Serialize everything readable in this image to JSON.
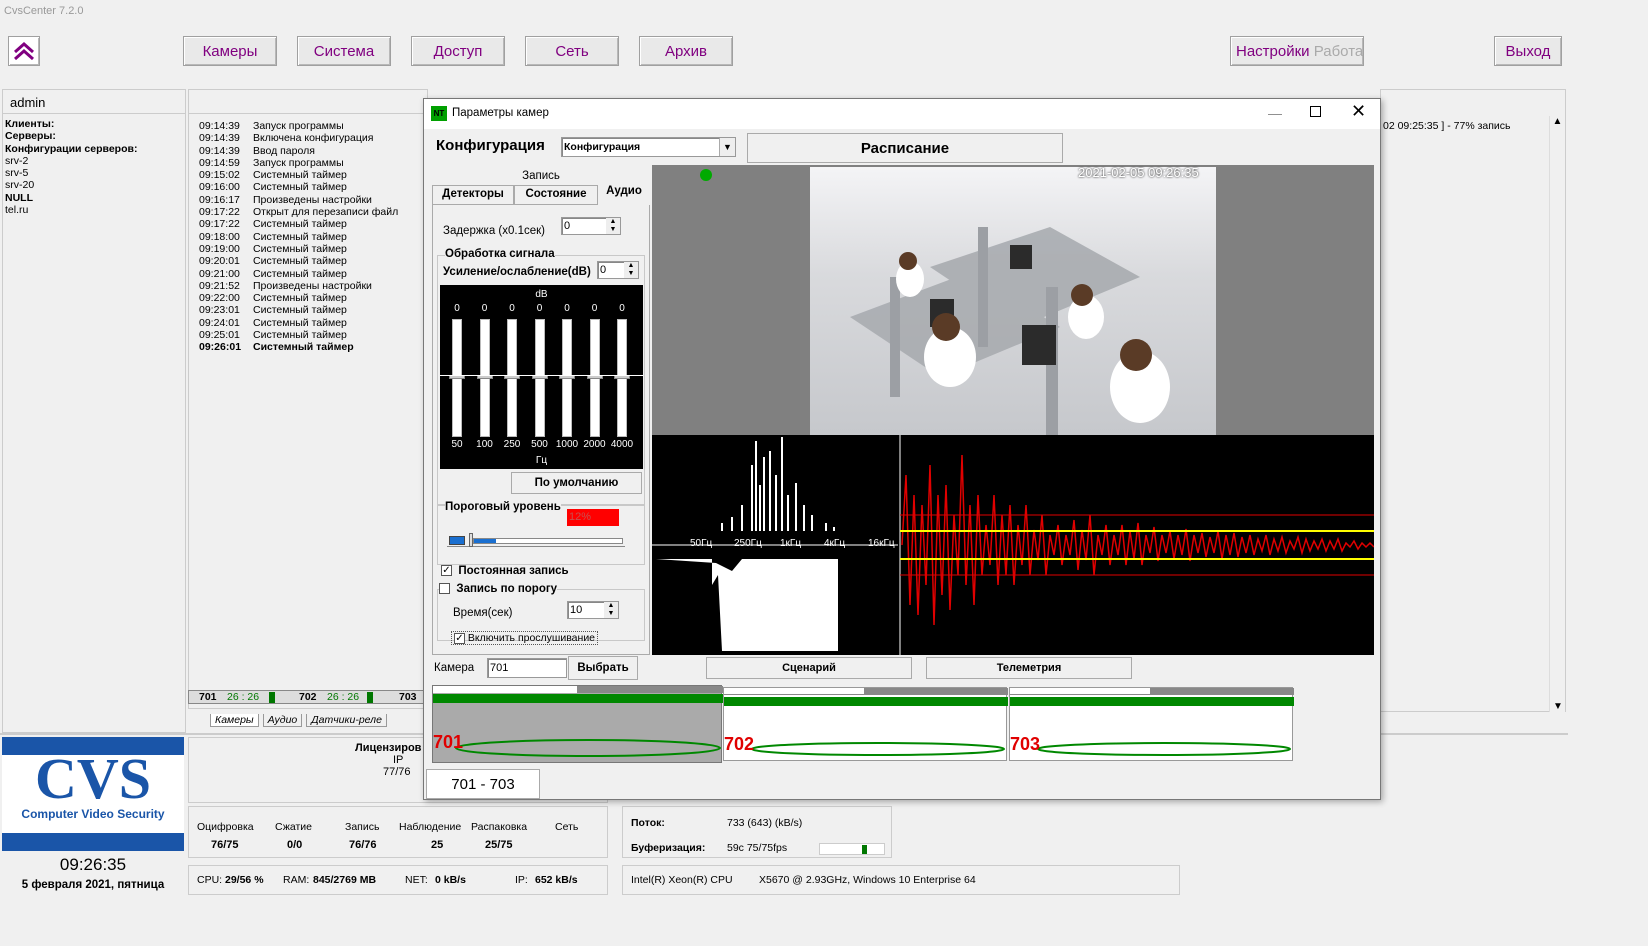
{
  "app": {
    "title": "CvsCenter 7.2.0"
  },
  "nav": {
    "cameras": "Камеры",
    "system": "Система",
    "access": "Доступ",
    "network": "Сеть",
    "archive": "Архив",
    "settings": "Настройки",
    "work": "Работа",
    "exit": "Выход"
  },
  "left": {
    "user": "admin",
    "tree": [
      "Клиенты:",
      "Серверы:",
      "Конфигурации серверов:",
      "srv-2",
      "srv-5",
      "srv-20",
      "NULL",
      "tel.ru"
    ]
  },
  "log": [
    [
      "09:14:39",
      "Запуск программы"
    ],
    [
      "09:14:39",
      "Включена конфигурация"
    ],
    [
      "09:14:39",
      "Ввод пароля"
    ],
    [
      "09:14:59",
      "Запуск программы"
    ],
    [
      "09:15:02",
      "Системный таймер"
    ],
    [
      "09:16:00",
      "Системный таймер"
    ],
    [
      "09:16:17",
      "Произведены настройки"
    ],
    [
      "09:17:22",
      "Открыт для перезаписи файл"
    ],
    [
      "09:17:22",
      "Системный таймер"
    ],
    [
      "09:18:00",
      "Системный таймер"
    ],
    [
      "09:19:00",
      "Системный таймер"
    ],
    [
      "09:20:01",
      "Системный таймер"
    ],
    [
      "09:21:00",
      "Системный таймер"
    ],
    [
      "09:21:52",
      "Произведены настройки"
    ],
    [
      "09:22:00",
      "Системный таймер"
    ],
    [
      "09:23:01",
      "Системный таймер"
    ],
    [
      "09:24:01",
      "Системный таймер"
    ],
    [
      "09:25:01",
      "Системный таймер"
    ],
    [
      "09:26:01",
      "Системный таймер"
    ]
  ],
  "right_log": "02 09:25:35 ] - 77% запись",
  "camstrip": [
    {
      "num": "701",
      "time": "26 : 26"
    },
    {
      "num": "702",
      "time": "26 : 26"
    },
    {
      "num": "703",
      "time": ""
    }
  ],
  "bottom_tabs": [
    "Камеры",
    "Аудио",
    "Датчики-реле"
  ],
  "logo": {
    "big": "CVS",
    "small": "Computer Video Security"
  },
  "clock": {
    "time": "09:26:35",
    "date": "5 февраля 2021, пятница"
  },
  "license": {
    "label": "Лицензиров",
    "ip": "IP",
    "value": "77/76"
  },
  "stats": {
    "headers": [
      "Оцифровка",
      "Сжатие",
      "Запись",
      "Наблюдение",
      "Распаковка",
      "Сеть"
    ],
    "values": [
      "76/75",
      "0/0",
      "76/76",
      "25",
      "25/75",
      ""
    ]
  },
  "sys": {
    "cpu_label": "CPU:",
    "cpu": "29/56 %",
    "ram_label": "RAM:",
    "ram": "845/2769 MB",
    "net_label": "NET:",
    "net": "0 kB/s",
    "ip_label": "IP:",
    "ip": "652 kB/s"
  },
  "stream": {
    "flow_label": "Поток:",
    "flow": "733 (643) (kB/s)",
    "buf_label": "Буферизация:",
    "buf": "59с 75/75fps",
    "cpu_info_a": "Intel(R) Xeon(R) CPU",
    "cpu_info_b": "X5670  @ 2.93GHz, Windows 10 Enterprise 64"
  },
  "dialog": {
    "title": "Параметры камер",
    "config_label": "Конфигурация",
    "config_value": "Конфигурация",
    "schedule": "Расписание",
    "tab_group": "Запись",
    "tabs": [
      "Детекторы",
      "Состояние",
      "Аудио"
    ],
    "delay_label": "Задержка (x0.1сек)",
    "delay_value": "0",
    "signal_group": "Обработка сигнала",
    "gain_label": "Усиление/ослабление(dB)",
    "gain_value": "0",
    "eq_db": "dB",
    "eq_hz": "Гц",
    "eq": [
      {
        "f": "50",
        "v": "0"
      },
      {
        "f": "100",
        "v": "0"
      },
      {
        "f": "250",
        "v": "0"
      },
      {
        "f": "500",
        "v": "0"
      },
      {
        "f": "1000",
        "v": "0"
      },
      {
        "f": "2000",
        "v": "0"
      },
      {
        "f": "4000",
        "v": "0"
      }
    ],
    "default_btn": "По умолчанию",
    "threshold_label": "Пороговый уровень",
    "threshold_value": "12%",
    "const_rec": "Постоянная запись",
    "thr_rec": "Запись по порогу",
    "time_label": "Время(сек)",
    "time_value": "10",
    "listen": "Включить прослушивание",
    "timestamp": "2021-02-05 09:26:35",
    "spectrum_labels": [
      "50Гц",
      "250Гц",
      "1кГц",
      "4кГц",
      "16кГц"
    ],
    "camera_label": "Камера",
    "camera_value": "701",
    "choose_btn": "Выбрать",
    "scenario_btn": "Сценарий",
    "telemetry_btn": "Телеметрия",
    "tiles": [
      "701",
      "702",
      "703"
    ],
    "range_tab": "701 - 703"
  }
}
